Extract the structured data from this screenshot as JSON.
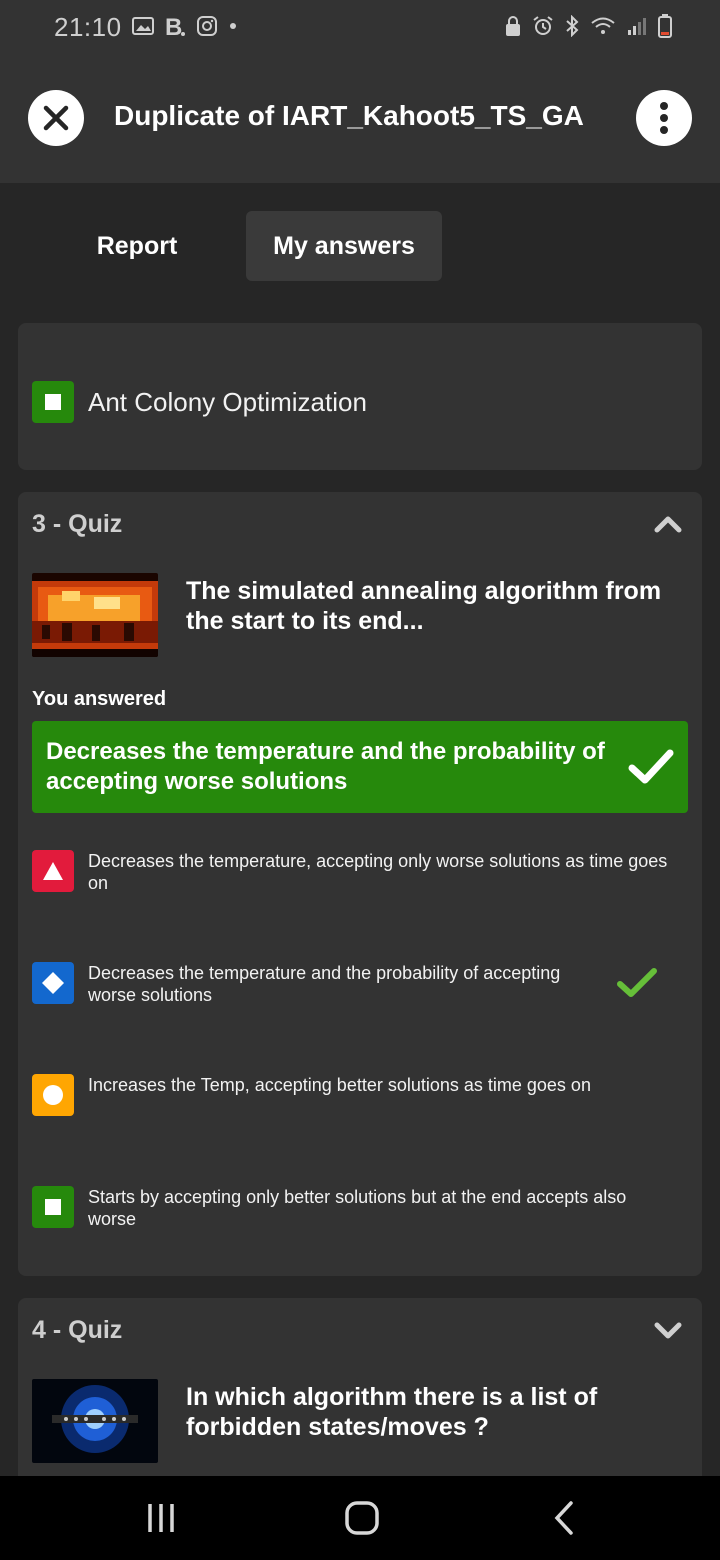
{
  "status_bar": {
    "time": "21:10"
  },
  "header": {
    "title": "Duplicate of IART_Kahoot5_TS_GA"
  },
  "tabs": [
    {
      "label": "Report"
    },
    {
      "label": "My answers"
    }
  ],
  "previous_card": {
    "option": "Ant Colony Optimization"
  },
  "quiz3": {
    "label": "3 - Quiz",
    "question": "The simulated annealing algorithm from the start to its end...",
    "answered_label": "You answered",
    "your_answer": "Decreases the temperature and the probability of accepting worse solutions",
    "options": [
      {
        "text": "Decreases the temperature, accepting only worse solutions as time goes on",
        "shape": "triangle",
        "color": "#e21b3c",
        "correct": false
      },
      {
        "text": "Decreases the temperature and the probability of accepting worse solutions",
        "shape": "diamond",
        "color": "#1368ce",
        "correct": true
      },
      {
        "text": "Increases the Temp, accepting better solutions as time goes on",
        "shape": "circle",
        "color": "#ffa602",
        "correct": false
      },
      {
        "text": "Starts by accepting only better solutions but at the end accepts also worse",
        "shape": "square",
        "color": "#26890c",
        "correct": false
      }
    ]
  },
  "quiz4": {
    "label": "4 - Quiz",
    "question": "In which algorithm there is a list of forbidden states/moves ?"
  },
  "colors": {
    "correct_green": "#26890c",
    "check_green": "#66bf39",
    "background": "#262626",
    "card": "#333333"
  }
}
